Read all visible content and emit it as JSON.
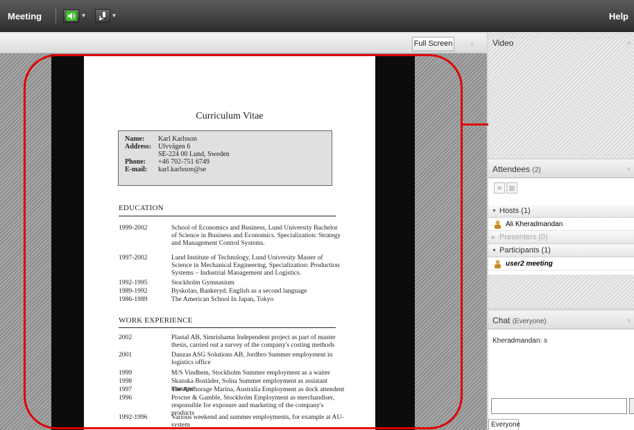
{
  "menubar": {
    "meeting": "Meeting",
    "help": "Help"
  },
  "share": {
    "fullscreen_label": "Full Screen",
    "document": {
      "title": "Curriculum Vitae",
      "info": [
        {
          "label": "Name:",
          "value": "Karl Karlsson"
        },
        {
          "label": "Address:",
          "value": "Ulvvägen 6"
        },
        {
          "label": "",
          "value": "SE-224 00 Lund, Sweden"
        },
        {
          "label": "Phone:",
          "value": "+46 702-751 6749"
        },
        {
          "label": "E-mail:",
          "value": "karl.karlsson@se"
        }
      ],
      "education_heading": "EDUCATION",
      "education": [
        {
          "year": "1999-2002",
          "text": "School of Economics and Business, Lund University Bachelor of Science in Business and Economics. Specialization: Strategy and Management Control Systems."
        },
        {
          "year": "1997-2002",
          "text": "Lund Institute of Technology, Lund University Master of Science in Mechanical Engineering. Specialization: Production Systems – Industrial Management and Logistics."
        },
        {
          "year": "1992-1995",
          "text": "Stockholm Gymnasium"
        },
        {
          "year": "1989-1992",
          "text": "Byskolan, Bankeryd. English as a second language"
        },
        {
          "year": "1986-1989",
          "text": "The American School In Japan, Tokyo"
        }
      ],
      "work_heading": "WORK EXPERIENCE",
      "work": [
        {
          "year": "2002",
          "text": "Plastal AB, Simrishamn Independent project as part of master thesis, carried out  a survey of the company's costing methods"
        },
        {
          "year": "2001",
          "text": "Danzas ASG Solutions AB, Jordbro Summer employment in logistics office"
        },
        {
          "year": "1999",
          "text": "M/S Vindhem, Stockholm Summer employment as a waiter"
        },
        {
          "year": "1998",
          "text": "Skanska Bostäder, Solna Summer employment as assistant manager"
        },
        {
          "year": "1997",
          "text": "The Anchorage Marina, Australia Employment as dock attendent"
        },
        {
          "year": "1996",
          "text": "Procter & Gamble, Stockholm Employment as merchandiser, responsible for exposure and marketing of the company's products"
        },
        {
          "year": "1992-1996",
          "text": "Various weekend and summer employments, for example at AU-system"
        }
      ]
    }
  },
  "video_pod": {
    "title": "Video"
  },
  "attendees_pod": {
    "title": "Attendees",
    "count": "(2)",
    "groups": {
      "hosts": "Hosts (1)",
      "host_user": "Ali Kheradmandan",
      "presenters": "Presenters (0)",
      "participants": "Participants (1)",
      "participant_user": "user2 meeting"
    }
  },
  "chat_pod": {
    "title": "Chat",
    "scope": "(Everyone)",
    "message": "Kheradmandan: s",
    "tab_label": "Everyone"
  },
  "colors": {
    "annotation_red": "#e00000",
    "speaker_green": "#3fbf2a"
  },
  "icons": [
    "speaker-icon",
    "microphone-icon",
    "pod-menu-icon",
    "user-icon",
    "list-view-icon",
    "grid-view-icon",
    "send-icon"
  ]
}
